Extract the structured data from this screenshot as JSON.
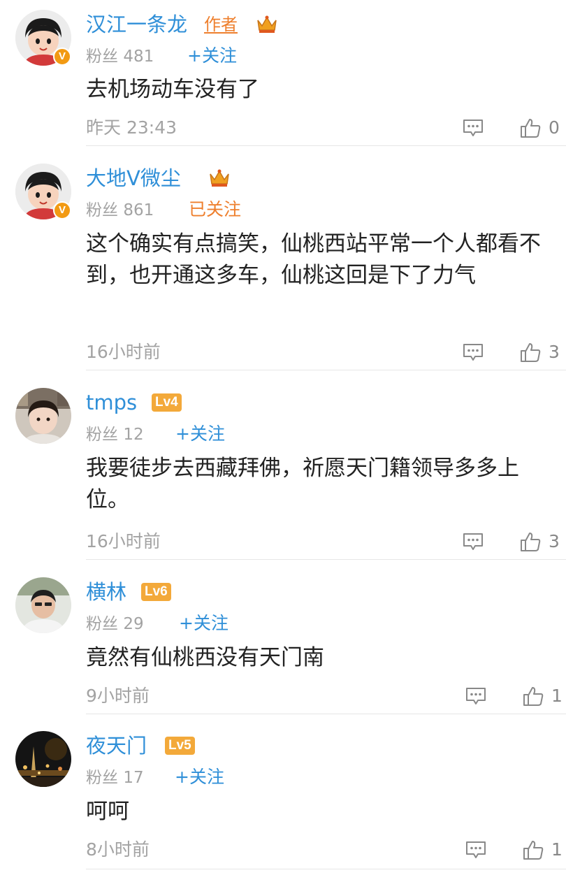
{
  "comments": [
    {
      "name": "汉江一条龙",
      "author_tag": "作者",
      "fans_label": "粉丝",
      "fans": "481",
      "follow_label": "+关注",
      "text": "去机场动车没有了",
      "time": "昨天 23:43",
      "likes": "0"
    },
    {
      "name": "大地V微尘",
      "fans_label": "粉丝",
      "fans": "861",
      "follow_label": "已关注",
      "text": "这个确实有点搞笑，仙桃西站平常一个人都看不到，也开通这多车，仙桃这回是下了力气",
      "time": "16小时前",
      "likes": "3"
    },
    {
      "name": "tmps",
      "level": "Lv4",
      "fans_label": "粉丝",
      "fans": "12",
      "follow_label": "+关注",
      "text": "我要徒步去西藏拜佛，祈愿天门籍领导多多上位。",
      "time": "16小时前",
      "likes": "3"
    },
    {
      "name": "横林",
      "level": "Lv6",
      "fans_label": "粉丝",
      "fans": "29",
      "follow_label": "+关注",
      "text": "竟然有仙桃西没有天门南",
      "time": "9小时前",
      "likes": "1"
    },
    {
      "name": "夜天门",
      "level": "Lv5",
      "fans_label": "粉丝",
      "fans": "17",
      "follow_label": "+关注",
      "text": "呵呵",
      "time": "8小时前",
      "likes": "1"
    }
  ],
  "colors": {
    "name": "#2f8fd8",
    "accent_orange": "#ee7f2d",
    "level_badge": "#f3a93a",
    "meta_gray": "#a3a3a3",
    "crown": "#f0a020"
  },
  "icons": {
    "avatar_badge": "verified-v-badge-icon",
    "crown": "crown-icon",
    "comment": "comment-bubble-icon",
    "like": "thumbs-up-icon"
  },
  "verified_badge_letter": "V"
}
